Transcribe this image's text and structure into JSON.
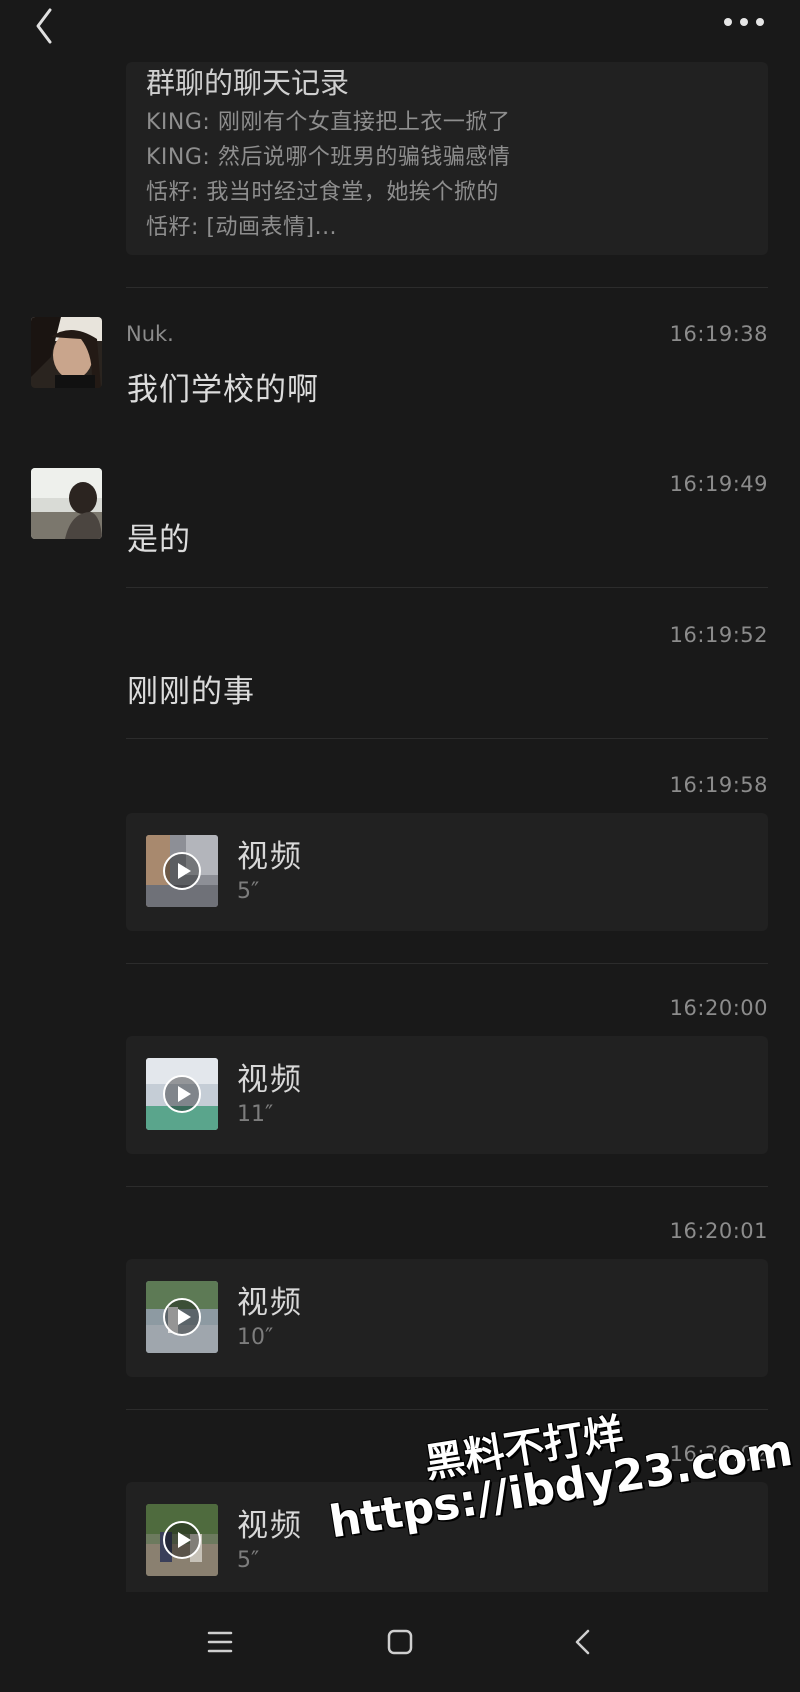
{
  "header": {
    "back_icon": "chevron-left-icon",
    "more_icon": "more-dots-icon"
  },
  "merged_record": {
    "title": "群聊的聊天记录",
    "lines": [
      "KING: 刚刚有个女直接把上衣一掀了",
      "KING: 然后说哪个班男的骗钱骗感情",
      "恬籽: 我当时经过食堂，她挨个掀的",
      "恬籽: [动画表情]..."
    ]
  },
  "messages": [
    {
      "sender": "Nuk.",
      "time": "16:19:38",
      "text": "我们学校的啊"
    },
    {
      "sender": "",
      "time": "16:19:49",
      "text": "是的"
    },
    {
      "sender": "",
      "time": "16:19:52",
      "text": "刚刚的事"
    }
  ],
  "videos": [
    {
      "time": "16:19:58",
      "label": "视频",
      "duration": "5″"
    },
    {
      "time": "16:20:00",
      "label": "视频",
      "duration": "11″"
    },
    {
      "time": "16:20:01",
      "label": "视频",
      "duration": "10″"
    },
    {
      "time": "16:20:02",
      "label": "视频",
      "duration": "5″"
    }
  ],
  "watermark": {
    "line1": "黑料不打烊",
    "line2": "https://ibdy23.com"
  },
  "navbar": {
    "menu_icon": "menu-icon",
    "home_icon": "home-square-icon",
    "back_icon": "nav-back-icon"
  }
}
